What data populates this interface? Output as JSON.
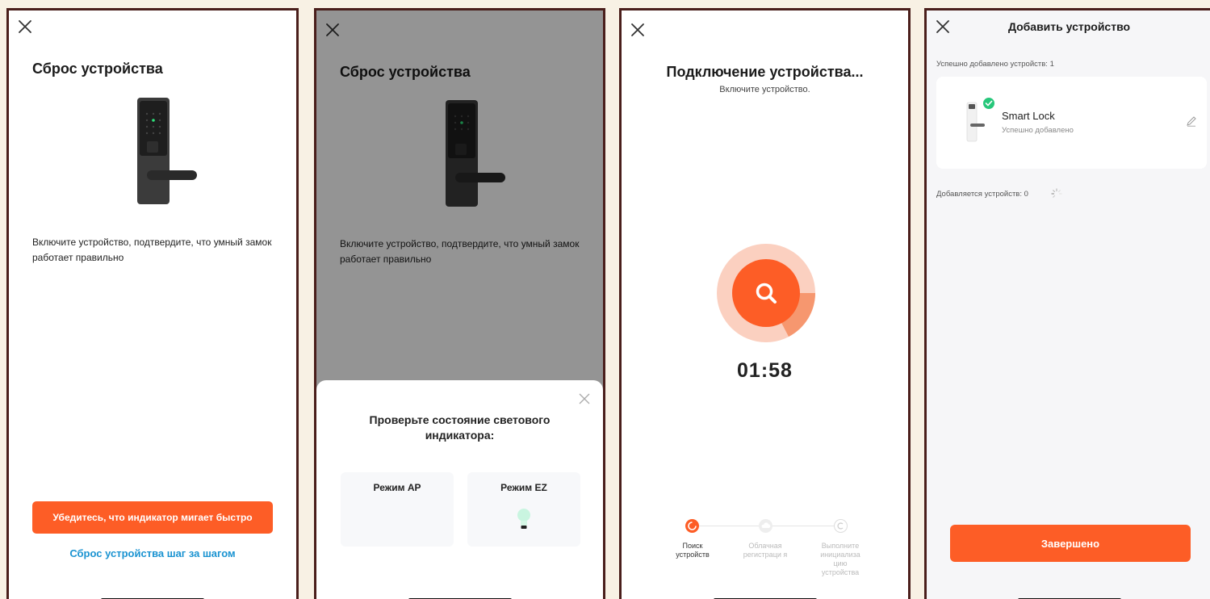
{
  "colors": {
    "accent": "#fd5d26",
    "link": "#1a93d1",
    "frame": "#4a1e1b",
    "success": "#26c77a"
  },
  "screen1": {
    "close_icon": "close-icon",
    "title": "Сброс устройства",
    "description": "Включите устройство, подтвердите, что умный замок работает правильно",
    "confirm_button": "Убедитесь, что индикатор мигает быстро",
    "reset_link": "Сброс устройства шаг за шагом"
  },
  "screen2": {
    "title": "Сброс устройства",
    "description": "Включите устройство, подтвердите, что умный замок работает правильно",
    "sheet": {
      "title": "Проверьте состояние светового индикатора:",
      "modes": [
        {
          "label": "Режим AP"
        },
        {
          "label": "Режим EZ"
        }
      ]
    }
  },
  "screen3": {
    "title": "Подключение устройства...",
    "subtitle": "Включите устройство.",
    "timer": "01:58",
    "steps": [
      {
        "label": "Поиск устройств",
        "active": true
      },
      {
        "label": "Облачная регистраци я",
        "active": false
      },
      {
        "label": "Выполните инициализа цию устройства",
        "active": false
      }
    ]
  },
  "screen4": {
    "title": "Добавить устройство",
    "added_count_text": "Успешно добавлено устройств: 1",
    "device": {
      "name": "Smart Lock",
      "status": "Успешно добавлено"
    },
    "adding_count_text": "Добавляется устройств: 0",
    "done_button": "Завершено"
  }
}
